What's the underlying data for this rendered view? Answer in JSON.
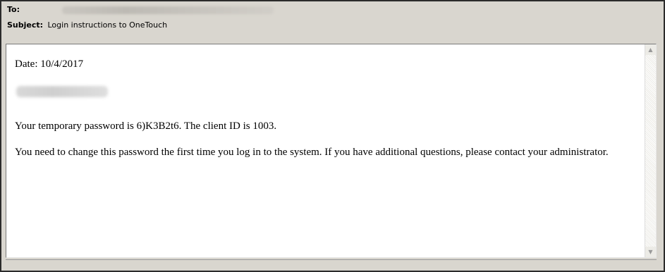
{
  "header": {
    "to_label": "To:",
    "to_value": "",
    "subject_label": "Subject:",
    "subject_value": "Login instructions to OneTouch"
  },
  "message": {
    "date_line": "Date: 10/4/2017",
    "password_line": "Your temporary password is 6)K3B2t6. The client ID is 1003.",
    "change_line": "You need to change this password the first time you log in to the system.  If you have additional questions, please contact your administrator."
  },
  "icons": {
    "scroll_up": "scroll-up-arrow",
    "scroll_down": "scroll-down-arrow"
  },
  "colors": {
    "chrome_background": "#d9d6cf",
    "body_background": "#ffffff",
    "frame_border": "#2b2b2b"
  }
}
